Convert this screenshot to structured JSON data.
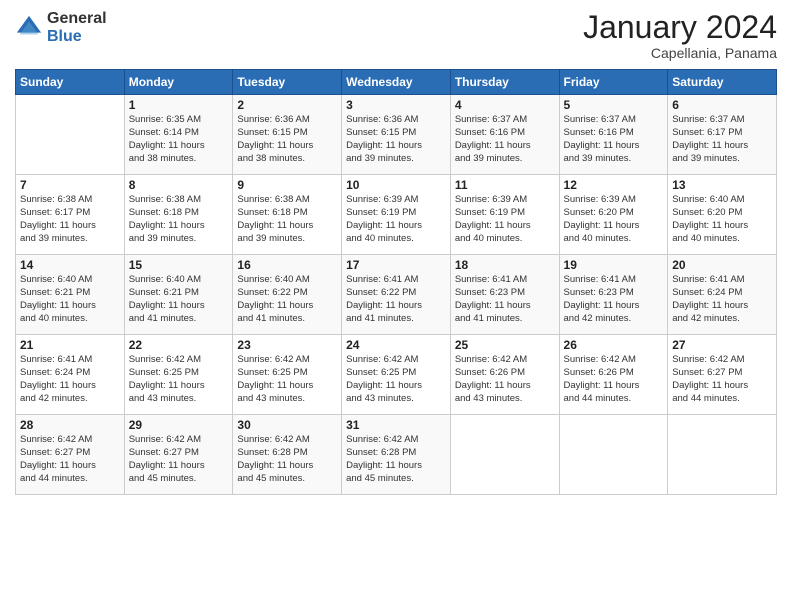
{
  "logo": {
    "general": "General",
    "blue": "Blue"
  },
  "title": "January 2024",
  "subtitle": "Capellania, Panama",
  "header_days": [
    "Sunday",
    "Monday",
    "Tuesday",
    "Wednesday",
    "Thursday",
    "Friday",
    "Saturday"
  ],
  "weeks": [
    [
      {
        "day": "",
        "info": ""
      },
      {
        "day": "1",
        "info": "Sunrise: 6:35 AM\nSunset: 6:14 PM\nDaylight: 11 hours\nand 38 minutes."
      },
      {
        "day": "2",
        "info": "Sunrise: 6:36 AM\nSunset: 6:15 PM\nDaylight: 11 hours\nand 38 minutes."
      },
      {
        "day": "3",
        "info": "Sunrise: 6:36 AM\nSunset: 6:15 PM\nDaylight: 11 hours\nand 39 minutes."
      },
      {
        "day": "4",
        "info": "Sunrise: 6:37 AM\nSunset: 6:16 PM\nDaylight: 11 hours\nand 39 minutes."
      },
      {
        "day": "5",
        "info": "Sunrise: 6:37 AM\nSunset: 6:16 PM\nDaylight: 11 hours\nand 39 minutes."
      },
      {
        "day": "6",
        "info": "Sunrise: 6:37 AM\nSunset: 6:17 PM\nDaylight: 11 hours\nand 39 minutes."
      }
    ],
    [
      {
        "day": "7",
        "info": "Sunrise: 6:38 AM\nSunset: 6:17 PM\nDaylight: 11 hours\nand 39 minutes."
      },
      {
        "day": "8",
        "info": "Sunrise: 6:38 AM\nSunset: 6:18 PM\nDaylight: 11 hours\nand 39 minutes."
      },
      {
        "day": "9",
        "info": "Sunrise: 6:38 AM\nSunset: 6:18 PM\nDaylight: 11 hours\nand 39 minutes."
      },
      {
        "day": "10",
        "info": "Sunrise: 6:39 AM\nSunset: 6:19 PM\nDaylight: 11 hours\nand 40 minutes."
      },
      {
        "day": "11",
        "info": "Sunrise: 6:39 AM\nSunset: 6:19 PM\nDaylight: 11 hours\nand 40 minutes."
      },
      {
        "day": "12",
        "info": "Sunrise: 6:39 AM\nSunset: 6:20 PM\nDaylight: 11 hours\nand 40 minutes."
      },
      {
        "day": "13",
        "info": "Sunrise: 6:40 AM\nSunset: 6:20 PM\nDaylight: 11 hours\nand 40 minutes."
      }
    ],
    [
      {
        "day": "14",
        "info": "Sunrise: 6:40 AM\nSunset: 6:21 PM\nDaylight: 11 hours\nand 40 minutes."
      },
      {
        "day": "15",
        "info": "Sunrise: 6:40 AM\nSunset: 6:21 PM\nDaylight: 11 hours\nand 41 minutes."
      },
      {
        "day": "16",
        "info": "Sunrise: 6:40 AM\nSunset: 6:22 PM\nDaylight: 11 hours\nand 41 minutes."
      },
      {
        "day": "17",
        "info": "Sunrise: 6:41 AM\nSunset: 6:22 PM\nDaylight: 11 hours\nand 41 minutes."
      },
      {
        "day": "18",
        "info": "Sunrise: 6:41 AM\nSunset: 6:23 PM\nDaylight: 11 hours\nand 41 minutes."
      },
      {
        "day": "19",
        "info": "Sunrise: 6:41 AM\nSunset: 6:23 PM\nDaylight: 11 hours\nand 42 minutes."
      },
      {
        "day": "20",
        "info": "Sunrise: 6:41 AM\nSunset: 6:24 PM\nDaylight: 11 hours\nand 42 minutes."
      }
    ],
    [
      {
        "day": "21",
        "info": "Sunrise: 6:41 AM\nSunset: 6:24 PM\nDaylight: 11 hours\nand 42 minutes."
      },
      {
        "day": "22",
        "info": "Sunrise: 6:42 AM\nSunset: 6:25 PM\nDaylight: 11 hours\nand 43 minutes."
      },
      {
        "day": "23",
        "info": "Sunrise: 6:42 AM\nSunset: 6:25 PM\nDaylight: 11 hours\nand 43 minutes."
      },
      {
        "day": "24",
        "info": "Sunrise: 6:42 AM\nSunset: 6:25 PM\nDaylight: 11 hours\nand 43 minutes."
      },
      {
        "day": "25",
        "info": "Sunrise: 6:42 AM\nSunset: 6:26 PM\nDaylight: 11 hours\nand 43 minutes."
      },
      {
        "day": "26",
        "info": "Sunrise: 6:42 AM\nSunset: 6:26 PM\nDaylight: 11 hours\nand 44 minutes."
      },
      {
        "day": "27",
        "info": "Sunrise: 6:42 AM\nSunset: 6:27 PM\nDaylight: 11 hours\nand 44 minutes."
      }
    ],
    [
      {
        "day": "28",
        "info": "Sunrise: 6:42 AM\nSunset: 6:27 PM\nDaylight: 11 hours\nand 44 minutes."
      },
      {
        "day": "29",
        "info": "Sunrise: 6:42 AM\nSunset: 6:27 PM\nDaylight: 11 hours\nand 45 minutes."
      },
      {
        "day": "30",
        "info": "Sunrise: 6:42 AM\nSunset: 6:28 PM\nDaylight: 11 hours\nand 45 minutes."
      },
      {
        "day": "31",
        "info": "Sunrise: 6:42 AM\nSunset: 6:28 PM\nDaylight: 11 hours\nand 45 minutes."
      },
      {
        "day": "",
        "info": ""
      },
      {
        "day": "",
        "info": ""
      },
      {
        "day": "",
        "info": ""
      }
    ]
  ],
  "colors": {
    "header_bg": "#2a6db5",
    "header_text": "#ffffff",
    "border": "#cccccc"
  }
}
